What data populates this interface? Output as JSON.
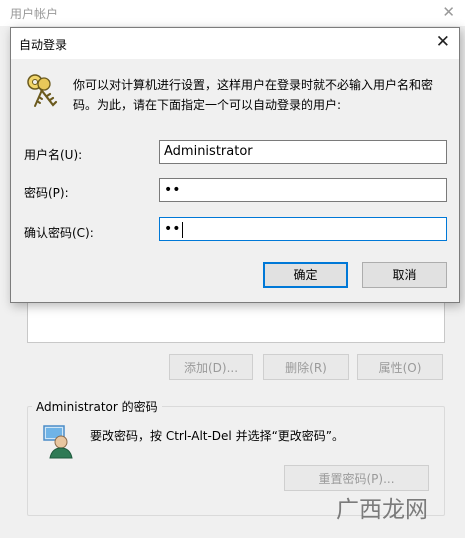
{
  "background_window": {
    "title": "用户帐户",
    "close_glyph": "✕",
    "buttons": {
      "add": "添加(D)...",
      "remove": "删除(R)",
      "properties": "属性(O)"
    },
    "password_group": {
      "legend": "Administrator 的密码",
      "message": "要改密码，按 Ctrl-Alt-Del 并选择“更改密码”。",
      "reset_button": "重置密码(P)..."
    }
  },
  "dialog": {
    "title": "自动登录",
    "close_glyph": "✕",
    "description": "你可以对计算机进行设置，这样用户在登录时就不必输入用户名和密码。为此，请在下面指定一个可以自动登录的用户:",
    "fields": {
      "username": {
        "label": "用户名(U):",
        "value": "Administrator"
      },
      "password": {
        "label": "密码(P):",
        "value": "••"
      },
      "confirm": {
        "label": "确认密码(C):",
        "value": "••"
      }
    },
    "ok": "确定",
    "cancel": "取消"
  },
  "watermark": {
    "text": "广西龙网"
  },
  "icons": {
    "dialog": "keys-icon",
    "user": "user-icon",
    "watermark": "watermark-logo"
  },
  "colors": {
    "focus_accent": "#0078d7",
    "window_bg": "#f0f0f0",
    "disabled_text": "#9a9a9a"
  }
}
